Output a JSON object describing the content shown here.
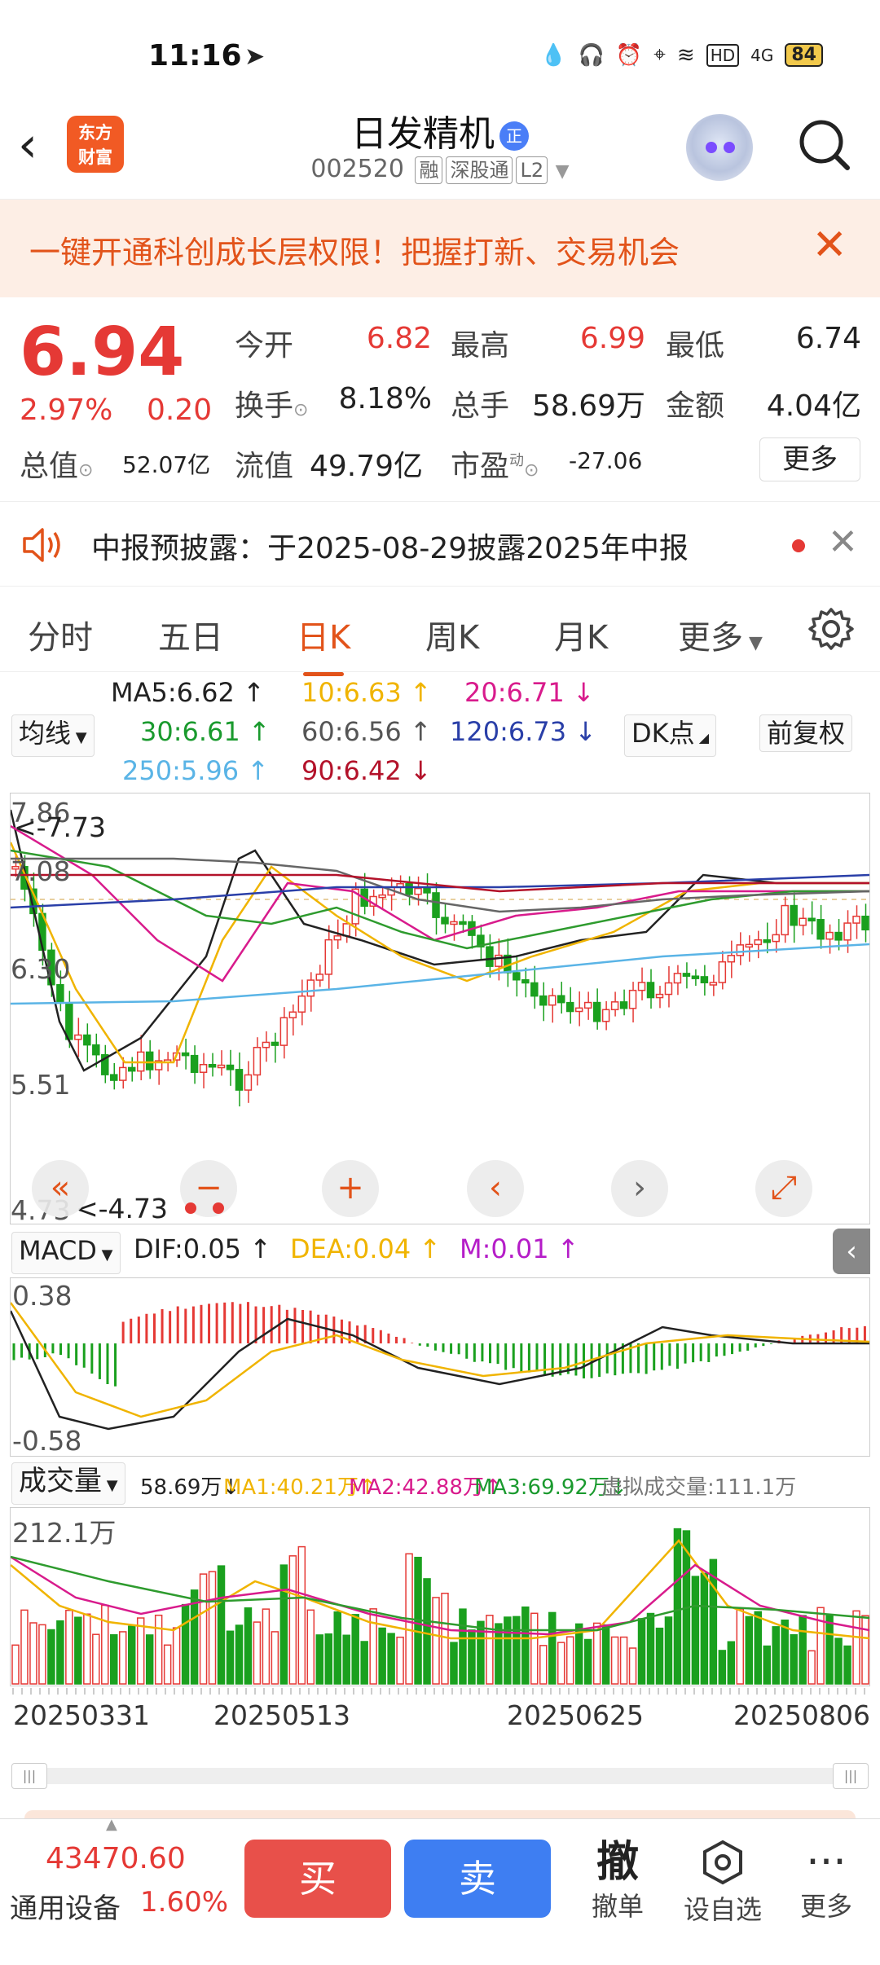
{
  "status_bar": {
    "time": "11:16",
    "battery": "84",
    "net": "4G",
    "hd": "HD"
  },
  "header": {
    "back": "‹",
    "logo_line1": "东方",
    "logo_line2": "财富",
    "title": "日发精机",
    "title_badge": "正",
    "code": "002520",
    "tags": [
      "融",
      "深股通",
      "L2"
    ]
  },
  "banner": {
    "text": "一键开通科创成长层权限！把握打新、交易机会",
    "close": "✕"
  },
  "quote": {
    "price": "6.94",
    "change_pct": "2.97%",
    "change": "0.20",
    "open_label": "今开",
    "open": "6.82",
    "high_label": "最高",
    "high": "6.99",
    "low_label": "最低",
    "low": "6.74",
    "turnover_label": "换手",
    "turnover": "8.18%",
    "volume_label": "总手",
    "volume": "58.69万",
    "amount_label": "金额",
    "amount": "4.04亿",
    "mktcap_label": "总值",
    "mktcap": "52.07亿",
    "float_label": "流值",
    "float": "49.79亿",
    "pe_label": "市盈",
    "pe_sup": "动",
    "pe": "-27.06",
    "more": "更多"
  },
  "notice": {
    "text": "中报预披露：于2025-08-29披露2025年中报",
    "close": "✕"
  },
  "tabs": [
    "分时",
    "五日",
    "日K",
    "周K",
    "月K",
    "更多"
  ],
  "active_tab": 2,
  "ma": {
    "ma5": "MA5:6.62",
    "ma10": "10:6.63",
    "ma20": "20:6.71",
    "ma30": "30:6.61",
    "ma60": "60:6.56",
    "ma120": "120:6.73",
    "ma250": "250:5.96",
    "ma90": "90:6.42",
    "selector": "均线",
    "dk": "DK点",
    "adjust": "前复权"
  },
  "main_chart": {
    "y_labels": [
      "7.86",
      "7.08",
      "6.30",
      "5.51",
      "4.73"
    ],
    "high_marker": "<-7.73",
    "low_marker": "<-4.73",
    "colors": {
      "up": "#e53935",
      "down": "#1aa01e",
      "ma5": "#222222",
      "ma10": "#f0b400",
      "ma20": "#d81b8c",
      "ma30": "#2e9b2e",
      "ma60": "#666666",
      "ma120": "#2a3fa8",
      "ma250": "#5ab4e6",
      "ma90": "#b3122a"
    }
  },
  "macd": {
    "selector": "MACD",
    "dif": "DIF:0.05",
    "dea": "DEA:0.04",
    "m": "M:0.01",
    "y_top": "0.38",
    "y_bottom": "-0.58"
  },
  "volume": {
    "selector": "成交量",
    "vol": "58.69万",
    "ma1": "MA1:40.21万",
    "ma2": "MA2:42.88万",
    "ma3": "MA3:69.92万",
    "virtual": "虚拟成交量:111.1万",
    "y_top": "212.1万"
  },
  "dates": [
    "20250331",
    "20250513",
    "20250625",
    "20250806"
  ],
  "bottom_bar": {
    "index_value": "43470.60",
    "index_name": "通用设备",
    "index_pct": "1.60%",
    "buy": "买",
    "sell": "卖",
    "cancel_icon": "撤",
    "cancel": "撤单",
    "watch": "设自选",
    "more": "更多"
  }
}
